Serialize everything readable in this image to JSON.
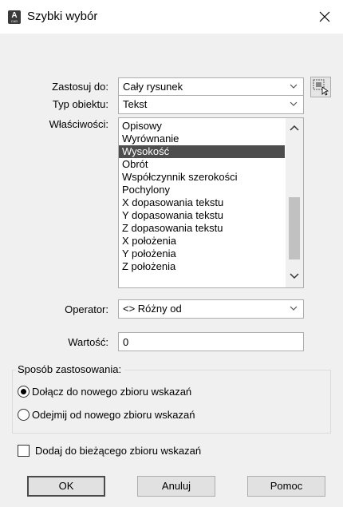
{
  "window": {
    "title": "Szybki wybór",
    "app_icon_letter": "A",
    "app_icon_sub": "CAD"
  },
  "apply_to": {
    "label": "Zastosuj do:",
    "value": "Cały rysunek"
  },
  "object_type": {
    "label": "Typ obiektu:",
    "value": "Tekst"
  },
  "properties": {
    "label": "Właściwości:",
    "items": [
      "Opisowy",
      "Wyrównanie",
      "Wysokość",
      "Obrót",
      "Współczynnik szerokości",
      "Pochylony",
      "X dopasowania tekstu",
      "Y dopasowania tekstu",
      "Z dopasowania tekstu",
      "X położenia",
      "Y położenia",
      "Z położenia"
    ],
    "selected_index": 2
  },
  "operator": {
    "label": "Operator:",
    "value": "<> Różny od"
  },
  "value": {
    "label": "Wartość:",
    "value": "0"
  },
  "apply_method": {
    "label": "Sposób zastosowania:",
    "options": [
      {
        "label": "Dołącz do nowego zbioru wskazań",
        "selected": true
      },
      {
        "label": "Odejmij od nowego zbioru wskazań",
        "selected": false
      }
    ]
  },
  "append": {
    "label": "Dodaj do bieżącego zbioru wskazań",
    "checked": false
  },
  "buttons": {
    "ok": "OK",
    "cancel": "Anuluj",
    "help": "Pomoc"
  }
}
